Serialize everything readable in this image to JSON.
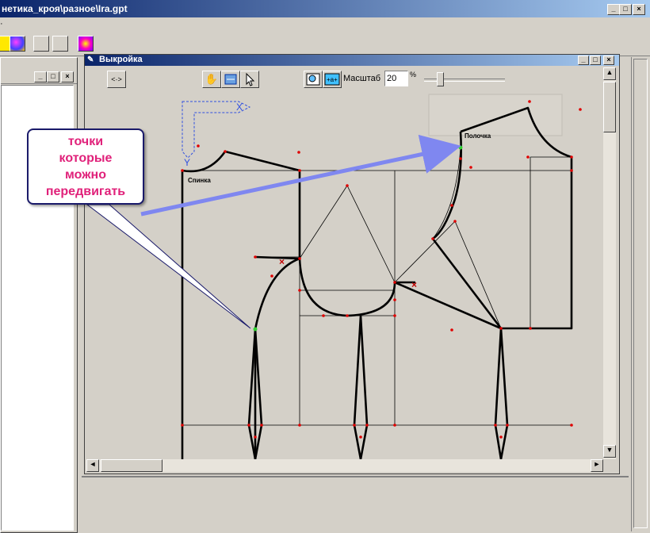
{
  "app": {
    "title": "нетика_кроя\\разное\\Ira.gpt",
    "menu_stub": "·"
  },
  "pattern_window": {
    "title": "Выкройка",
    "move_label": "<·>",
    "scale_label": "Масштаб",
    "scale_value": "20",
    "scale_unit": "%"
  },
  "drawing_labels": {
    "back_piece": "Спинка",
    "front_piece": "Полочка",
    "x_axis": "X",
    "y_axis": "Y"
  },
  "annotation": {
    "text_line1": "точки",
    "text_line2": "которые",
    "text_line3": "можно",
    "text_line4": "передвигать"
  },
  "colors": {
    "titlebar": "#0a246a",
    "annotation_text": "#e0217a",
    "arrow": "#7f87f0",
    "points": "#e00000"
  },
  "icons": [
    "hand-icon",
    "pen-icon",
    "cursor-icon",
    "zoom-frame-icon",
    "zoom-fit-icon",
    "palette-icon",
    "wand-icon"
  ]
}
